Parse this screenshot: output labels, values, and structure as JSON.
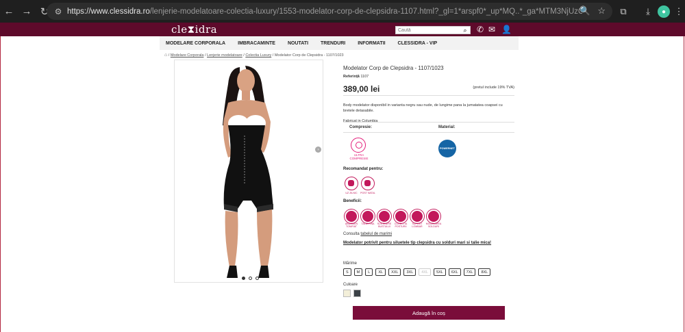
{
  "browser": {
    "url_host": "https://www.clessidra.ro",
    "url_path": "/lenjerie-modelatoare-colectia-luxury/1553-modelator-corp-de-clepsidra-1107.html?_gl=1*arspf0*_up*MQ..*_ga*MTM3NjUzOTgyNi4xNzM3NDczNjk1*_ga_QY..."
  },
  "header": {
    "logo": "cle⧗idra",
    "search_placeholder": "Caută"
  },
  "nav": {
    "items": [
      "MODELARE CORPORALA",
      "IMBRACAMINTE",
      "NOUTATI",
      "TRENDURI",
      "INFORMATII",
      "CLESSIDRA - VIP"
    ]
  },
  "breadcrumb": {
    "items": [
      "Modelare Corporala",
      "Lenjerie modelatoare",
      "Colectia Luxury"
    ],
    "current": "Modelator Corp de Clepsidra - 1107/1023",
    "sep": "/"
  },
  "product": {
    "title": "Modelator Corp de Clepsidra - 1107/1023",
    "ref_label": "Referință",
    "ref_value": "1107",
    "price": "389,00 lei",
    "vat_note": "(pretul include 19% TVA)",
    "description": "Body modelator disponibil in varianta negru sau nude, de lungime pana la jumatatea coapsei cu bretele detasabile.",
    "origin": "Fabricat in Columbia",
    "compression_label": "Compresie:",
    "material_label": "Material:",
    "compression_value": "ULTRA COMPRESIE",
    "material_value": "POWERNET",
    "recommended_title": "Recomandat pentru:",
    "recommended": [
      "UZ ZILNIC",
      "POST NATAL"
    ],
    "benefits_title": "Beneficii:",
    "benefits": [
      "ABDOMEN TONIFIAT",
      "TALIE FINA",
      "SUSTINERE BUSTULUI",
      "CORECTIA POSTURII",
      "SUPORT LOMBAR",
      "MODELAREA SOLDURI"
    ],
    "size_guide_prefix": "Consulta",
    "size_guide_link": "tabelul de marimi",
    "recommendation": "Modelator potrivit pentru siluetele tip clepsidra cu solduri mari si talie mica!",
    "size_label": "Mărime",
    "sizes": [
      "S",
      "M",
      "L",
      "XL",
      "XXL",
      "3XL",
      "4XL",
      "5XL",
      "6XL",
      "7XL",
      "8XL"
    ],
    "color_label": "Culoare",
    "colors": [
      "#f3efd9",
      "#3b4147"
    ],
    "add_to_cart": "Adaugă în coș"
  }
}
